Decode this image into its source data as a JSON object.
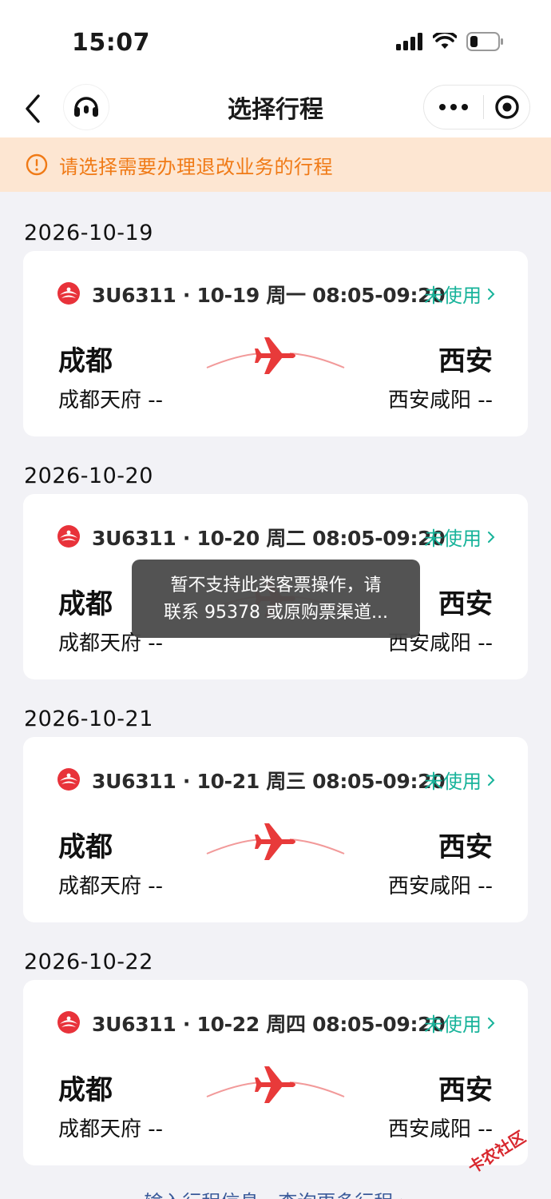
{
  "status_bar": {
    "time": "15:07",
    "icons": [
      "cellular-signal-icon",
      "wifi-icon",
      "battery-icon"
    ]
  },
  "nav": {
    "title": "选择行程",
    "back_icon": "chevron-left-icon",
    "service_icon": "headset-icon",
    "more_icon": "more-dots-icon",
    "close_icon": "record-target-icon"
  },
  "notice": {
    "icon": "alert-circle-icon",
    "text": "请选择需要办理退改业务的行程",
    "color": "#f07a16"
  },
  "trips": [
    {
      "date": "2026-10-19",
      "flight": "3U6311 · 10-19 周一 08:05-09:20",
      "status": "未使用",
      "from_city": "成都",
      "from_airport": "成都天府 --",
      "to_city": "西安",
      "to_airport": "西安咸阳 --"
    },
    {
      "date": "2026-10-20",
      "flight": "3U6311 · 10-20 周二 08:05-09:20",
      "status": "未使用",
      "from_city": "成都",
      "from_airport": "成都天府 --",
      "to_city": "西安",
      "to_airport": "西安咸阳 --"
    },
    {
      "date": "2026-10-21",
      "flight": "3U6311 · 10-21 周三 08:05-09:20",
      "status": "未使用",
      "from_city": "成都",
      "from_airport": "成都天府 --",
      "to_city": "西安",
      "to_airport": "西安咸阳 --"
    },
    {
      "date": "2026-10-22",
      "flight": "3U6311 · 10-22 周四 08:05-09:20",
      "status": "未使用",
      "from_city": "成都",
      "from_airport": "成都天府 --",
      "to_city": "西安",
      "to_airport": "西安咸阳 --"
    }
  ],
  "toast": {
    "line1": "暂不支持此类客票操作，请",
    "line2": "联系 95378 或原购票渠道..."
  },
  "bottom_link": "输入行程信息，查询更多行程 ›",
  "watermark": "卡农社区",
  "colors": {
    "accent_green": "#17b39a",
    "plane_red": "#e83a3a",
    "link_blue": "#3a5a9a"
  }
}
